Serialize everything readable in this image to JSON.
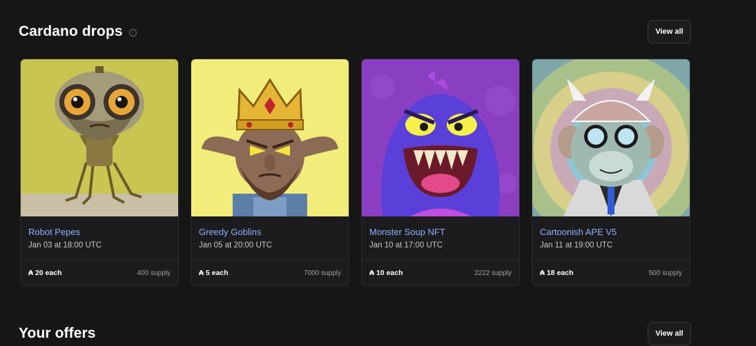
{
  "drops_section": {
    "title": "Cardano drops",
    "info_icon": "info-icon",
    "view_all_label": "View all"
  },
  "drops": [
    {
      "name": "Robot Pepes",
      "date": "Jan 03 at 18:00 UTC",
      "price": "20 each",
      "supply": "400 supply",
      "bg": "#c8c650"
    },
    {
      "name": "Greedy Goblins",
      "date": "Jan 05 at 20:00 UTC",
      "price": "5 each",
      "supply": "7000 supply",
      "bg": "#f2ed7a"
    },
    {
      "name": "Monster Soup NFT",
      "date": "Jan 10 at 17:00 UTC",
      "price": "10 each",
      "supply": "2222 supply",
      "bg": "#8a3fc2"
    },
    {
      "name": "Cartoonish APE V5",
      "date": "Jan 11 at 19:00 UTC",
      "price": "18 each",
      "supply": "500 supply",
      "bg": "#6b85b8"
    }
  ],
  "currency_symbol": "₳",
  "offers_section": {
    "title": "Your offers",
    "view_all_label": "View all"
  }
}
